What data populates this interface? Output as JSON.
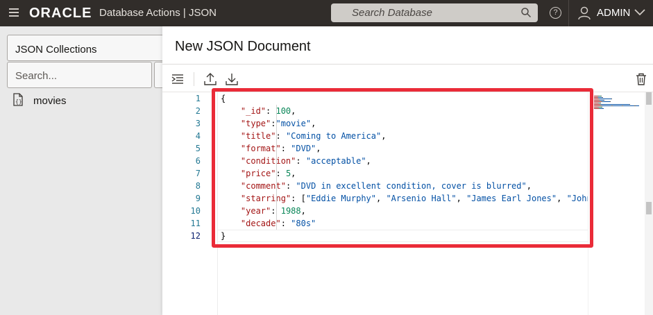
{
  "topbar": {
    "brand": "ORACLE",
    "product": "Database Actions | JSON",
    "search_placeholder": "Search Database",
    "help": "?",
    "user": "ADMIN"
  },
  "sidebar": {
    "collections_label": "JSON Collections",
    "search_placeholder": "Search...",
    "items": [
      {
        "label": "movies"
      }
    ]
  },
  "editor": {
    "title": "New JSON Document",
    "line_numbers": [
      "1",
      "2",
      "3",
      "4",
      "5",
      "6",
      "7",
      "8",
      "9",
      "10",
      "11",
      "12"
    ],
    "current_line": "12",
    "lines": [
      {
        "parts": [
          {
            "t": "p",
            "v": "{"
          }
        ]
      },
      {
        "parts": [
          {
            "t": "p",
            "v": "    "
          },
          {
            "t": "k",
            "v": "\"_id\""
          },
          {
            "t": "p",
            "v": ": "
          },
          {
            "t": "n",
            "v": "100"
          },
          {
            "t": "p",
            "v": ","
          }
        ]
      },
      {
        "parts": [
          {
            "t": "p",
            "v": "    "
          },
          {
            "t": "k",
            "v": "\"type\""
          },
          {
            "t": "p",
            "v": ":"
          },
          {
            "t": "s",
            "v": "\"movie\""
          },
          {
            "t": "p",
            "v": ","
          }
        ]
      },
      {
        "parts": [
          {
            "t": "p",
            "v": "    "
          },
          {
            "t": "k",
            "v": "\"title\""
          },
          {
            "t": "p",
            "v": ": "
          },
          {
            "t": "s",
            "v": "\"Coming to America\""
          },
          {
            "t": "p",
            "v": ","
          }
        ]
      },
      {
        "parts": [
          {
            "t": "p",
            "v": "    "
          },
          {
            "t": "k",
            "v": "\"format\""
          },
          {
            "t": "p",
            "v": ": "
          },
          {
            "t": "s",
            "v": "\"DVD\""
          },
          {
            "t": "p",
            "v": ","
          }
        ]
      },
      {
        "parts": [
          {
            "t": "p",
            "v": "    "
          },
          {
            "t": "k",
            "v": "\"condition\""
          },
          {
            "t": "p",
            "v": ": "
          },
          {
            "t": "s",
            "v": "\"acceptable\""
          },
          {
            "t": "p",
            "v": ","
          }
        ]
      },
      {
        "parts": [
          {
            "t": "p",
            "v": "    "
          },
          {
            "t": "k",
            "v": "\"price\""
          },
          {
            "t": "p",
            "v": ": "
          },
          {
            "t": "n",
            "v": "5"
          },
          {
            "t": "p",
            "v": ","
          }
        ]
      },
      {
        "parts": [
          {
            "t": "p",
            "v": "    "
          },
          {
            "t": "k",
            "v": "\"comment\""
          },
          {
            "t": "p",
            "v": ": "
          },
          {
            "t": "s",
            "v": "\"DVD in excellent condition, cover is blurred\""
          },
          {
            "t": "p",
            "v": ","
          }
        ]
      },
      {
        "parts": [
          {
            "t": "p",
            "v": "    "
          },
          {
            "t": "k",
            "v": "\"starring\""
          },
          {
            "t": "p",
            "v": ": ["
          },
          {
            "t": "s",
            "v": "\"Eddie Murphy\""
          },
          {
            "t": "p",
            "v": ", "
          },
          {
            "t": "s",
            "v": "\"Arsenio Hall\""
          },
          {
            "t": "p",
            "v": ", "
          },
          {
            "t": "s",
            "v": "\"James Earl Jones\""
          },
          {
            "t": "p",
            "v": ", "
          },
          {
            "t": "s",
            "v": "\"John"
          }
        ]
      },
      {
        "parts": [
          {
            "t": "p",
            "v": "    "
          },
          {
            "t": "k",
            "v": "\"year\""
          },
          {
            "t": "p",
            "v": ": "
          },
          {
            "t": "n",
            "v": "1988"
          },
          {
            "t": "p",
            "v": ","
          }
        ]
      },
      {
        "parts": [
          {
            "t": "p",
            "v": "    "
          },
          {
            "t": "k",
            "v": "\"decade\""
          },
          {
            "t": "p",
            "v": ": "
          },
          {
            "t": "s",
            "v": "\"80s\""
          }
        ]
      },
      {
        "parts": [
          {
            "t": "p",
            "v": "}"
          }
        ]
      }
    ]
  },
  "colors": {
    "topbar": "#312d2a",
    "highlight": "#ea2b38",
    "key": "#a31515",
    "string": "#0451a5",
    "number": "#098658",
    "line_number": "#237893"
  }
}
